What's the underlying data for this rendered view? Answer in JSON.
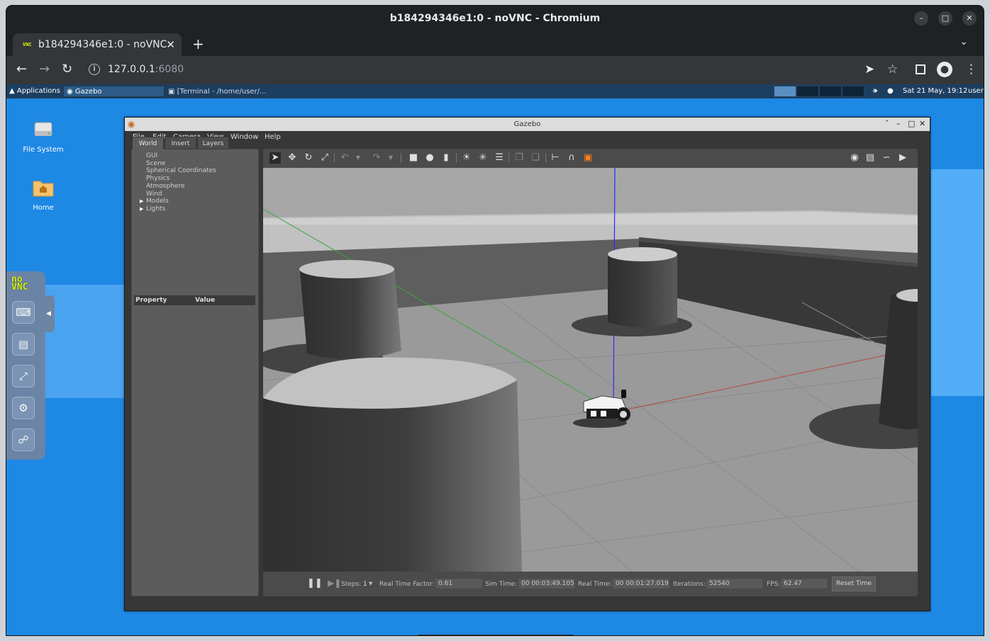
{
  "browser": {
    "window_title": "b184294346e1:0 - noVNC - Chromium",
    "tab_title": "b184294346e1:0 - noVNC",
    "favicon_text": "VNC",
    "url_host": "127.0.0.1",
    "url_port": ":6080"
  },
  "panel": {
    "applications": "Applications :",
    "tasks": [
      {
        "label": "Gazebo"
      },
      {
        "label": "[Terminal - /home/user/..."
      }
    ],
    "clock": "Sat 21 May, 19:12",
    "user": "user"
  },
  "desktop_icons": [
    {
      "label": "File System"
    },
    {
      "label": "Home"
    }
  ],
  "novnc": {
    "logo_top": "no",
    "logo_bottom": "VNC"
  },
  "gazebo": {
    "window_title": "Gazebo",
    "menu": [
      "File",
      "Edit",
      "Camera",
      "View",
      "Window",
      "Help"
    ],
    "left_tabs": [
      "World",
      "Insert",
      "Layers"
    ],
    "tree": [
      "GUI",
      "Scene",
      "Spherical Coordinates",
      "Physics",
      "Atmosphere",
      "Wind",
      "Models",
      "Lights"
    ],
    "property_header": {
      "property": "Property",
      "value": "Value"
    },
    "bottom": {
      "steps_label": "Steps:",
      "steps_value": "1",
      "rtf_label": "Real Time Factor:",
      "rtf_value": "0.61",
      "sim_time_label": "Sim Time:",
      "sim_time_value": "00 00:03:49.105",
      "real_time_label": "Real Time:",
      "real_time_value": "00 00:01:27.019",
      "iterations_label": "Iterations:",
      "iterations_value": "52540",
      "fps_label": "FPS:",
      "fps_value": "62.47",
      "reset_label": "Reset Time"
    }
  },
  "colors": {
    "desktop_bg": "#1e88e5",
    "chrome_dark": "#202124",
    "gazebo_panel": "#5c5c5c",
    "x_axis": "#c0392b",
    "y_axis": "#27ae60",
    "z_axis": "#2020ff"
  }
}
